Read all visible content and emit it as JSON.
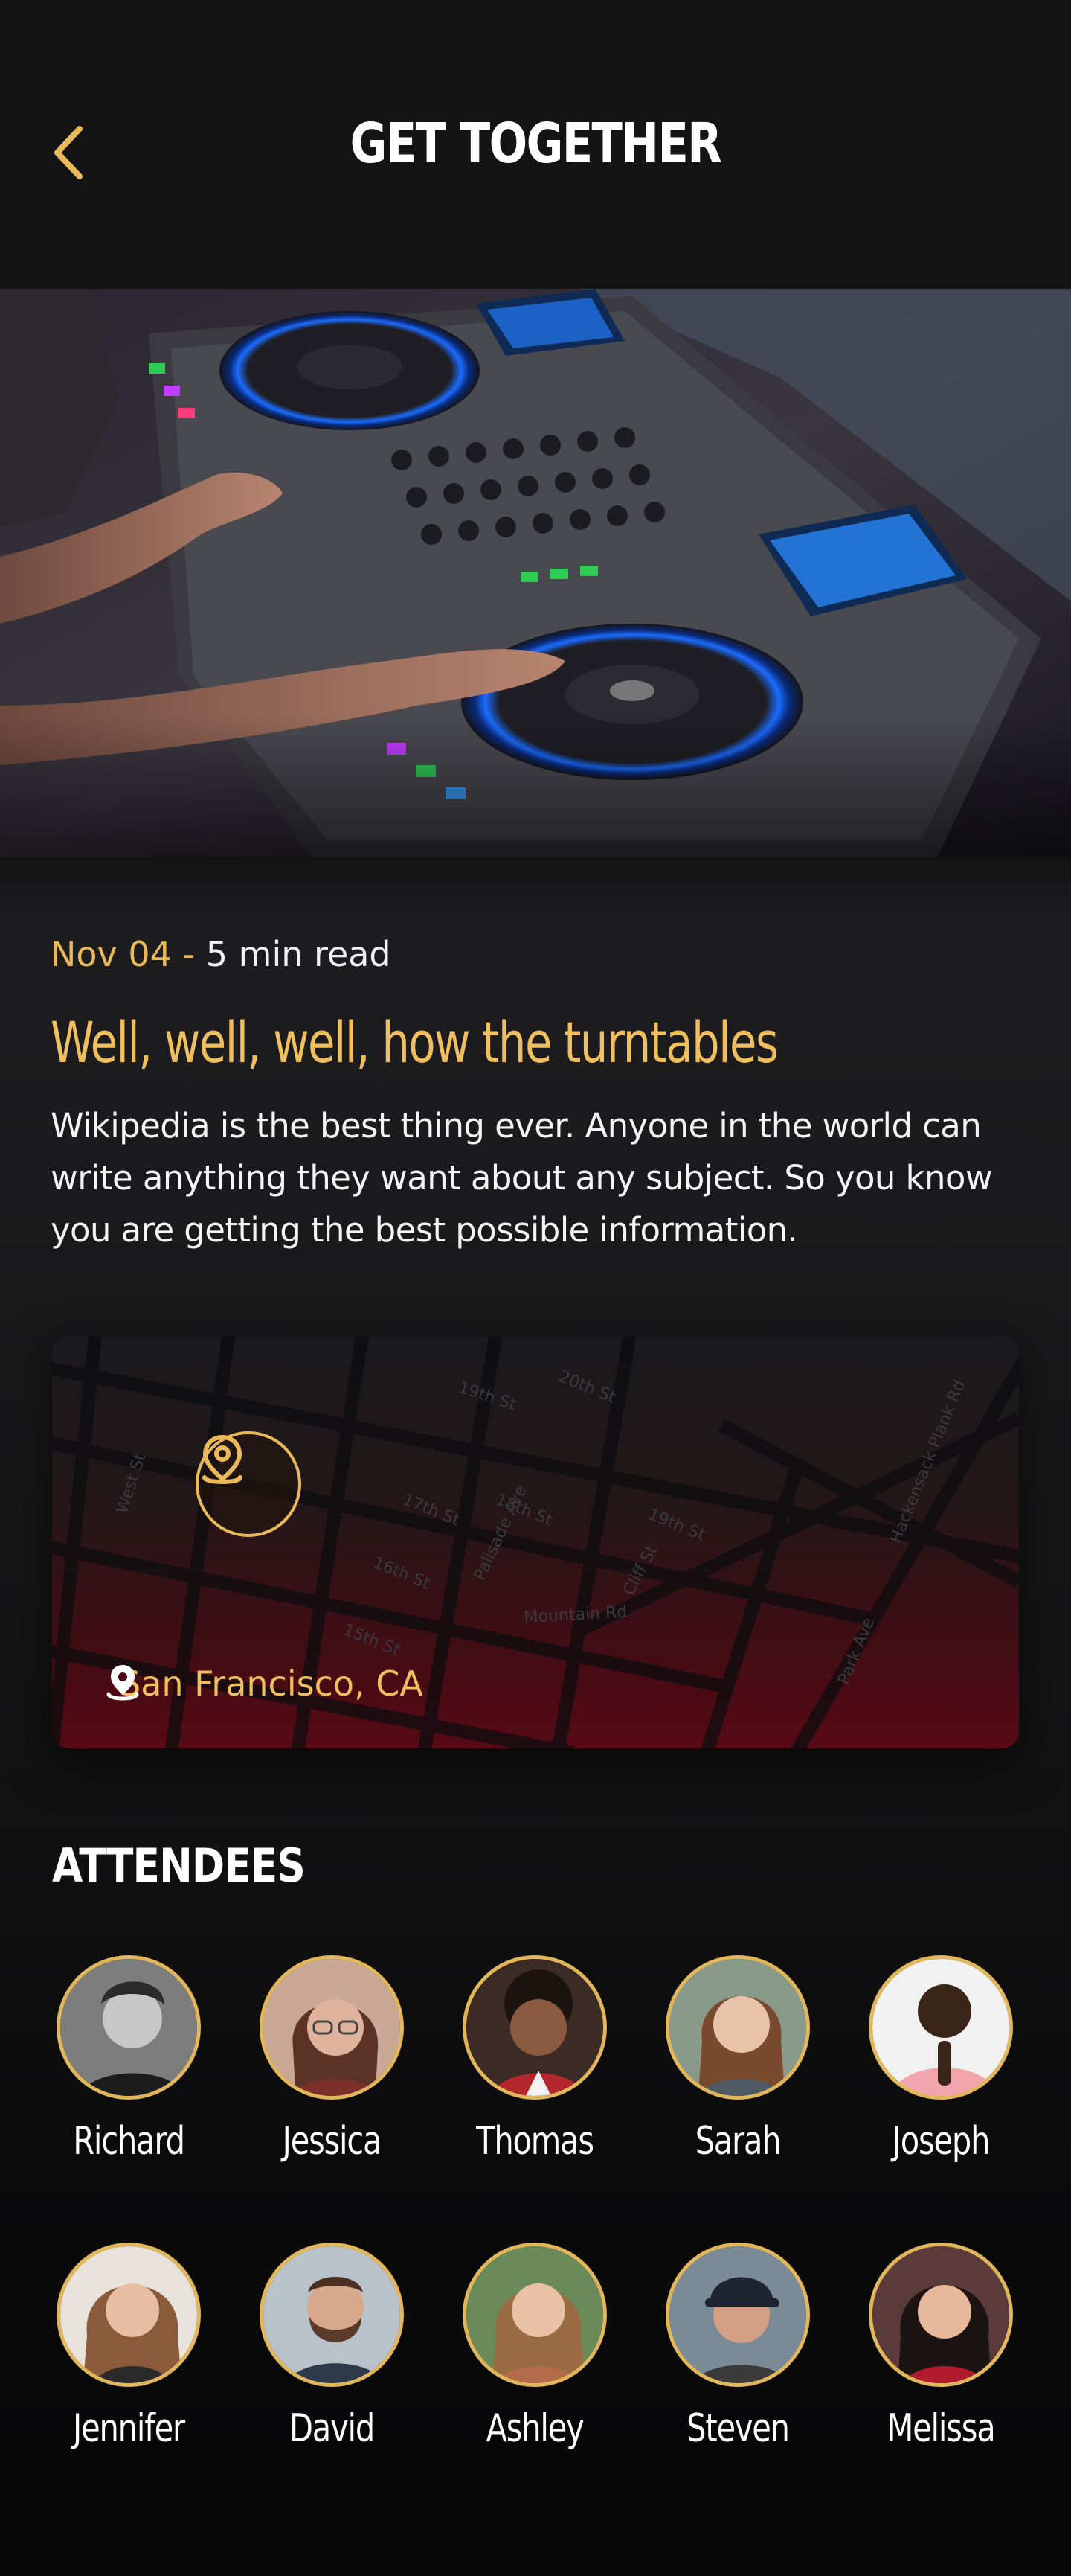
{
  "header": {
    "title": "GET TOGETHER",
    "back_icon": "chevron-left-icon"
  },
  "colors": {
    "accent": "#F0BF5F",
    "background": "#141415",
    "map_gradient_end": "#560A15"
  },
  "article": {
    "date": "Nov 04",
    "separator": " - ",
    "read_time": "5 min read",
    "title": "Well, well, well, how the turntables",
    "body": "Wikipedia is the best thing ever. Anyone in the world can write anything they want about any subject. So you know you are getting the best possible information."
  },
  "map": {
    "location": "San Francisco, CA",
    "street_labels": [
      "19th St",
      "20th St",
      "West St",
      "17th St",
      "18th St",
      "19th St",
      "Palisade Ave",
      "16th St",
      "Cliff St",
      "Mountain Rd",
      "15th St",
      "Hackensack Plank Rd",
      "Park Ave"
    ]
  },
  "attendees": {
    "title": "ATTENDEES",
    "people": [
      {
        "name": "Richard"
      },
      {
        "name": "Jessica"
      },
      {
        "name": "Thomas"
      },
      {
        "name": "Sarah"
      },
      {
        "name": "Joseph"
      },
      {
        "name": "Jennifer"
      },
      {
        "name": "David"
      },
      {
        "name": "Ashley"
      },
      {
        "name": "Steven"
      },
      {
        "name": "Melissa"
      }
    ]
  }
}
